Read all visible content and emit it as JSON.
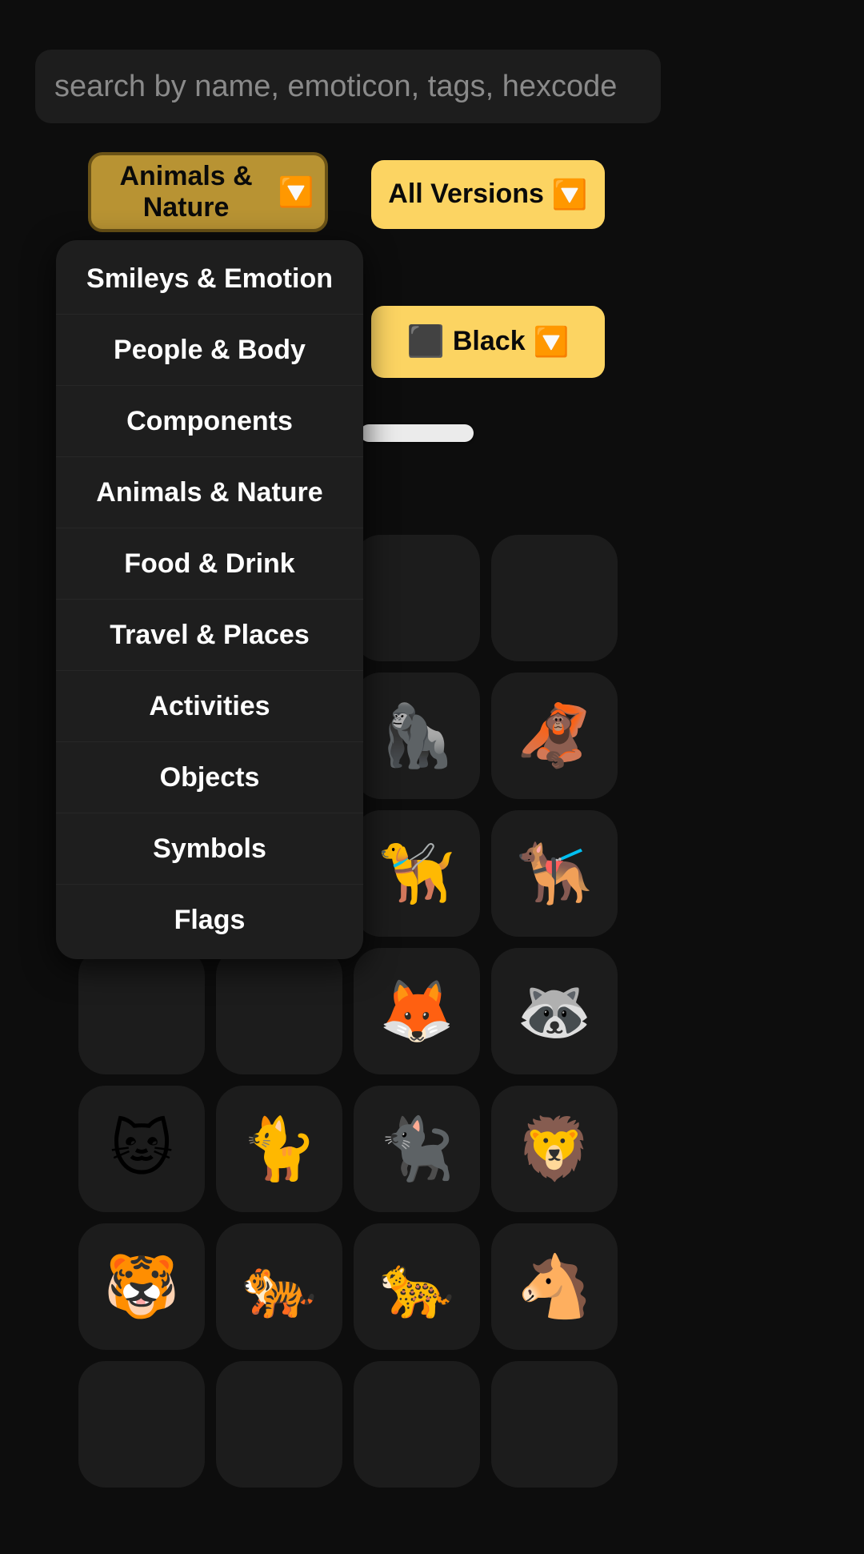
{
  "theme": {
    "background": "#0d0d0d",
    "accent_gold": "#fcd462",
    "accent_gold_pressed": "#b89333",
    "panel": "#1e1e1e",
    "tile": "#1c1c1c",
    "text": "#ffffff",
    "placeholder": "#8a8a8a"
  },
  "search": {
    "value": "",
    "placeholder": "search by name, emoticon, tags, hexcode"
  },
  "controls": {
    "category": {
      "label": "Animals & Nature",
      "chevron": "🔽",
      "state": "pressed"
    },
    "versions": {
      "label": "All Versions",
      "chevron": "🔽"
    },
    "color": {
      "swatch": "⬛",
      "label": "Black",
      "chevron": "🔽"
    },
    "slider": {
      "value": ""
    }
  },
  "dropdown": {
    "open": true,
    "selected": "Animals & Nature",
    "items": [
      {
        "label": "Smileys & Emotion"
      },
      {
        "label": "People & Body"
      },
      {
        "label": "Components"
      },
      {
        "label": "Animals & Nature"
      },
      {
        "label": "Food & Drink"
      },
      {
        "label": "Travel & Places"
      },
      {
        "label": "Activities"
      },
      {
        "label": "Objects"
      },
      {
        "label": "Symbols"
      },
      {
        "label": "Flags"
      }
    ]
  },
  "emoji_grid": {
    "columns": 4,
    "cells": [
      {
        "glyph": "",
        "name": "emoji-hidden-1"
      },
      {
        "glyph": "",
        "name": "emoji-hidden-2"
      },
      {
        "glyph": "",
        "name": "emoji-hidden-3"
      },
      {
        "glyph": "",
        "name": "emoji-hidden-4"
      },
      {
        "glyph": "",
        "name": "emoji-hidden-5"
      },
      {
        "glyph": "",
        "name": "emoji-hidden-6"
      },
      {
        "glyph": "🦍",
        "name": "gorilla"
      },
      {
        "glyph": "🦧",
        "name": "orangutan"
      },
      {
        "glyph": "",
        "name": "emoji-hidden-7"
      },
      {
        "glyph": "",
        "name": "emoji-hidden-8"
      },
      {
        "glyph": "🦮",
        "name": "guide-dog"
      },
      {
        "glyph": "🐕‍🦺",
        "name": "service-dog"
      },
      {
        "glyph": "",
        "name": "emoji-hidden-9"
      },
      {
        "glyph": "",
        "name": "emoji-hidden-10"
      },
      {
        "glyph": "🦊",
        "name": "fox"
      },
      {
        "glyph": "🦝",
        "name": "raccoon"
      },
      {
        "glyph": "🐱",
        "name": "cat-face"
      },
      {
        "glyph": "🐈",
        "name": "cat"
      },
      {
        "glyph": "🐈‍⬛",
        "name": "black-cat"
      },
      {
        "glyph": "🦁",
        "name": "lion"
      },
      {
        "glyph": "🐯",
        "name": "tiger-face"
      },
      {
        "glyph": "🐅",
        "name": "tiger"
      },
      {
        "glyph": "🐆",
        "name": "leopard"
      },
      {
        "glyph": "🐴",
        "name": "horse-face"
      },
      {
        "glyph": "",
        "name": "emoji-partial-1"
      },
      {
        "glyph": "",
        "name": "emoji-partial-2"
      },
      {
        "glyph": "",
        "name": "emoji-partial-3"
      },
      {
        "glyph": "",
        "name": "emoji-partial-4"
      }
    ]
  }
}
